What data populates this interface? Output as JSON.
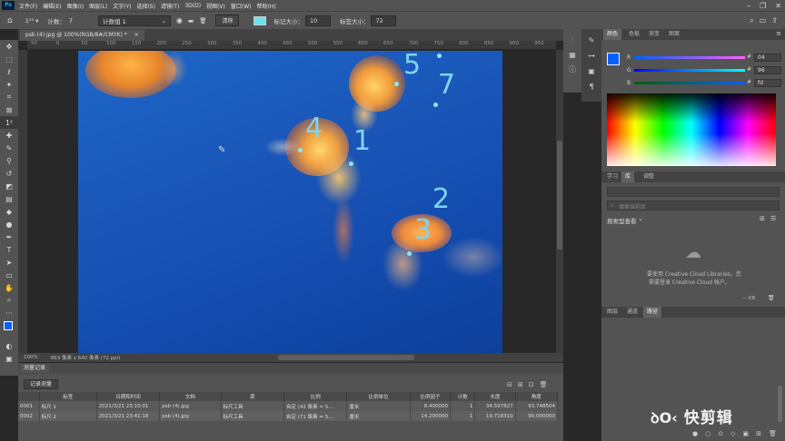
{
  "menubar": {
    "logo": "Ps",
    "items": [
      "文件(F)",
      "编辑(E)",
      "图像(I)",
      "图层(L)",
      "文字(Y)",
      "选择(S)",
      "滤镜(T)",
      "3D(D)",
      "视图(V)",
      "窗口(W)",
      "帮助(H)"
    ]
  },
  "optionsbar": {
    "count_label": "计数：",
    "count_value": "7",
    "group_label": "计数组 1",
    "clear_label": "清除",
    "marker_size_label": "标记大小：",
    "marker_size_value": "10",
    "label_size_label": "标签大小：",
    "label_size_value": "72"
  },
  "document": {
    "tab_title": "psb (4).jpg @ 100%(RGB/8#/CMYK) *",
    "status_zoom": "100%",
    "status_info": "863 像素 x 640 像素 (72 ppi)"
  },
  "ruler": {
    "ticks": [
      "50",
      "0",
      "50",
      "100",
      "150",
      "200",
      "250",
      "300",
      "350",
      "400",
      "450",
      "500",
      "550",
      "600",
      "650",
      "700",
      "750",
      "800",
      "850",
      "900",
      "950"
    ]
  },
  "canvas": {
    "count_labels": [
      "1",
      "2",
      "3",
      "4",
      "5",
      "7"
    ]
  },
  "measurement_log": {
    "panel_title": "测量记录",
    "record_button": "记录测量",
    "columns": [
      "标签",
      "日期和时间",
      "文档",
      "源",
      "比例",
      "比例单位",
      "比例因子",
      "计数",
      "长度",
      "角度"
    ],
    "rows": [
      [
        "0001",
        "标尺 1",
        "2021/3/21 23:10:01",
        "psb (4).jpg",
        "标尺工具",
        "自定 (42 像素 = 5....",
        "厘米",
        "8.400000",
        "1",
        "34.597827",
        "93.748504"
      ],
      [
        "0002",
        "标尺 2",
        "2021/3/21 23:41:18",
        "psb (4).jpg",
        "标尺工具",
        "自定 (71 像素 = 5....",
        "厘米",
        "14.200000",
        "1",
        "19.718310",
        "90.000000"
      ]
    ]
  },
  "right_panel": {
    "top_tabs": [
      "颜色",
      "色板",
      "渐变",
      "图案"
    ],
    "r_label": "R",
    "g_label": "G",
    "b_label": "B",
    "r_value": "04",
    "g_value": "96",
    "b_value": "fd",
    "mid_tabs": [
      "学习",
      "库",
      "调整"
    ],
    "search_placeholder": "搜索当前库",
    "sort_label": "按类型查看",
    "cc_message_line1": "要使用 Creative Cloud Libraries，您",
    "cc_message_line2": "需要登录 Creative Cloud 帐户。",
    "kb_label": "-- KB",
    "bottom_tabs": [
      "图层",
      "通道",
      "路径"
    ]
  },
  "watermark": "快剪辑"
}
